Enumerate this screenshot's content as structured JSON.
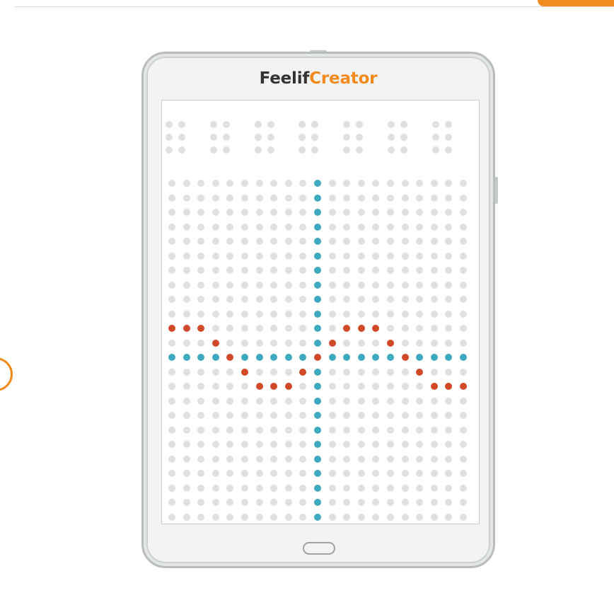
{
  "brand": {
    "name_part1": "Feelif",
    "name_part2": "Creator",
    "color_dark": "#333333",
    "color_accent": "#f28a1e"
  },
  "colors": {
    "dot_off": "#e0e0e0",
    "axis_dot": "#3fa9bf",
    "graph_dot": "#d04a29",
    "accent": "#f28a1e"
  },
  "braille_cells": {
    "count": 7,
    "dots_per_cell": 6
  },
  "grid": {
    "columns": 21,
    "rows": 24,
    "axis_column": 10,
    "axis_row": 12,
    "graph_points": [
      [
        0,
        10
      ],
      [
        1,
        10
      ],
      [
        2,
        10
      ],
      [
        3,
        11
      ],
      [
        4,
        12
      ],
      [
        5,
        13
      ],
      [
        6,
        14
      ],
      [
        7,
        14
      ],
      [
        8,
        14
      ],
      [
        9,
        13
      ],
      [
        10,
        12
      ],
      [
        11,
        11
      ],
      [
        12,
        10
      ],
      [
        13,
        10
      ],
      [
        14,
        10
      ],
      [
        15,
        11
      ],
      [
        16,
        12
      ],
      [
        17,
        13
      ],
      [
        18,
        14
      ],
      [
        19,
        14
      ],
      [
        20,
        14
      ]
    ]
  },
  "icons": {
    "home": "home-button-icon"
  }
}
